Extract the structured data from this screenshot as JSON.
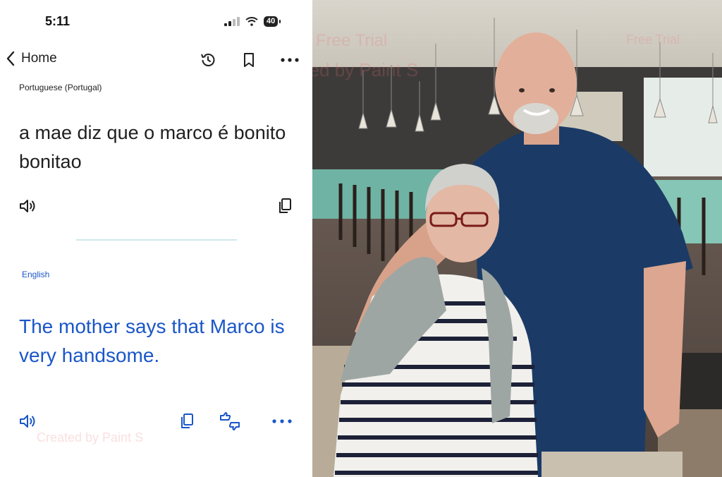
{
  "status_bar": {
    "time": "5:11",
    "battery": "40"
  },
  "nav": {
    "back_label": "Home"
  },
  "source": {
    "language": "Portuguese (Portugal)",
    "text": "a mae diz que o marco é bonito bonitao"
  },
  "target": {
    "language": "English",
    "text": "The mother says that Marco is very handsome."
  },
  "watermarks": {
    "free_trial": "Free Trial",
    "created_by": "Created by Paint S"
  },
  "icons": {
    "back": "chevron-left-icon",
    "history": "history-icon",
    "bookmark": "bookmark-icon",
    "more": "more-horizontal-icon",
    "speaker": "speaker-icon",
    "copy": "copy-icon",
    "feedback": "thumbs-up-down-icon"
  },
  "colors": {
    "accent_blue": "#1a56c8",
    "divider": "#cfe8ee",
    "text": "#1f1f1f"
  }
}
